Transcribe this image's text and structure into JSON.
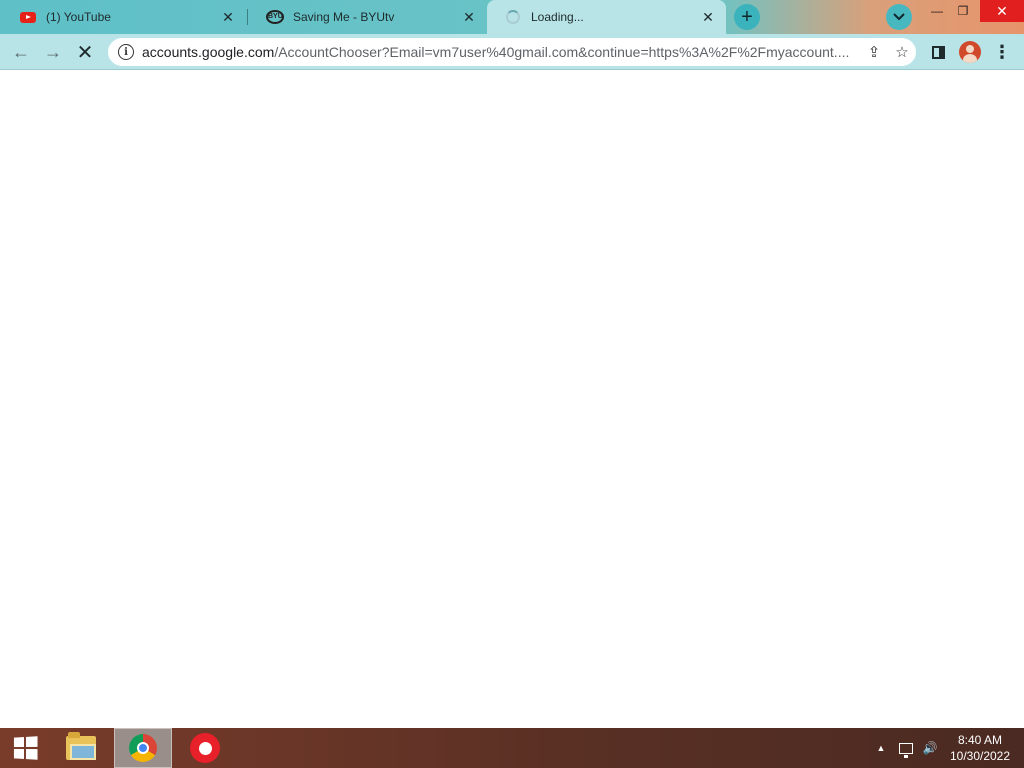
{
  "browser": {
    "tabs": [
      {
        "title": "(1) YouTube",
        "icon": "youtube-icon",
        "active": false
      },
      {
        "title": "Saving Me - BYUtv",
        "icon": "byutv-icon",
        "active": false
      },
      {
        "title": "Loading...",
        "icon": "loading-spinner-icon",
        "active": true
      }
    ],
    "close_glyph": "✕",
    "new_tab_glyph": "+",
    "window_controls": {
      "minimize": "—",
      "maximize": "❐",
      "close": "✕"
    }
  },
  "toolbar": {
    "back_glyph": "←",
    "forward_glyph": "→",
    "stop_glyph": "✕",
    "url_domain": "accounts.google.com",
    "url_path": "/AccountChooser?Email=vm7user%40gmail.com&continue=https%3A%2F%2Fmyaccount....",
    "share_glyph": "⇪",
    "bookmark_glyph": "☆",
    "menu_glyph": "⋮"
  },
  "taskbar": {
    "apps": [
      "file-explorer",
      "google-chrome",
      "screen-recorder"
    ],
    "tray_up_glyph": "▲",
    "volume_glyph": "🔊",
    "time": "8:40 AM",
    "date": "10/30/2022"
  }
}
